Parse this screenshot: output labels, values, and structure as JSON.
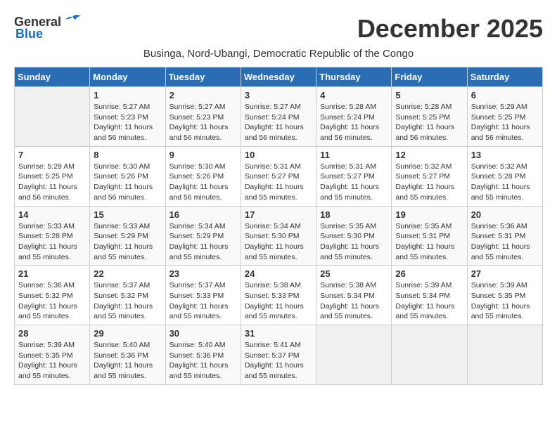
{
  "logo": {
    "general": "General",
    "blue": "Blue"
  },
  "title": "December 2025",
  "subtitle": "Businga, Nord-Ubangi, Democratic Republic of the Congo",
  "days_of_week": [
    "Sunday",
    "Monday",
    "Tuesday",
    "Wednesday",
    "Thursday",
    "Friday",
    "Saturday"
  ],
  "weeks": [
    [
      {
        "day": "",
        "sunrise": "",
        "sunset": "",
        "daylight": ""
      },
      {
        "day": "1",
        "sunrise": "Sunrise: 5:27 AM",
        "sunset": "Sunset: 5:23 PM",
        "daylight": "Daylight: 11 hours and 56 minutes."
      },
      {
        "day": "2",
        "sunrise": "Sunrise: 5:27 AM",
        "sunset": "Sunset: 5:23 PM",
        "daylight": "Daylight: 11 hours and 56 minutes."
      },
      {
        "day": "3",
        "sunrise": "Sunrise: 5:27 AM",
        "sunset": "Sunset: 5:24 PM",
        "daylight": "Daylight: 11 hours and 56 minutes."
      },
      {
        "day": "4",
        "sunrise": "Sunrise: 5:28 AM",
        "sunset": "Sunset: 5:24 PM",
        "daylight": "Daylight: 11 hours and 56 minutes."
      },
      {
        "day": "5",
        "sunrise": "Sunrise: 5:28 AM",
        "sunset": "Sunset: 5:25 PM",
        "daylight": "Daylight: 11 hours and 56 minutes."
      },
      {
        "day": "6",
        "sunrise": "Sunrise: 5:29 AM",
        "sunset": "Sunset: 5:25 PM",
        "daylight": "Daylight: 11 hours and 56 minutes."
      }
    ],
    [
      {
        "day": "7",
        "sunrise": "Sunrise: 5:29 AM",
        "sunset": "Sunset: 5:25 PM",
        "daylight": "Daylight: 11 hours and 56 minutes."
      },
      {
        "day": "8",
        "sunrise": "Sunrise: 5:30 AM",
        "sunset": "Sunset: 5:26 PM",
        "daylight": "Daylight: 11 hours and 56 minutes."
      },
      {
        "day": "9",
        "sunrise": "Sunrise: 5:30 AM",
        "sunset": "Sunset: 5:26 PM",
        "daylight": "Daylight: 11 hours and 56 minutes."
      },
      {
        "day": "10",
        "sunrise": "Sunrise: 5:31 AM",
        "sunset": "Sunset: 5:27 PM",
        "daylight": "Daylight: 11 hours and 55 minutes."
      },
      {
        "day": "11",
        "sunrise": "Sunrise: 5:31 AM",
        "sunset": "Sunset: 5:27 PM",
        "daylight": "Daylight: 11 hours and 55 minutes."
      },
      {
        "day": "12",
        "sunrise": "Sunrise: 5:32 AM",
        "sunset": "Sunset: 5:27 PM",
        "daylight": "Daylight: 11 hours and 55 minutes."
      },
      {
        "day": "13",
        "sunrise": "Sunrise: 5:32 AM",
        "sunset": "Sunset: 5:28 PM",
        "daylight": "Daylight: 11 hours and 55 minutes."
      }
    ],
    [
      {
        "day": "14",
        "sunrise": "Sunrise: 5:33 AM",
        "sunset": "Sunset: 5:28 PM",
        "daylight": "Daylight: 11 hours and 55 minutes."
      },
      {
        "day": "15",
        "sunrise": "Sunrise: 5:33 AM",
        "sunset": "Sunset: 5:29 PM",
        "daylight": "Daylight: 11 hours and 55 minutes."
      },
      {
        "day": "16",
        "sunrise": "Sunrise: 5:34 AM",
        "sunset": "Sunset: 5:29 PM",
        "daylight": "Daylight: 11 hours and 55 minutes."
      },
      {
        "day": "17",
        "sunrise": "Sunrise: 5:34 AM",
        "sunset": "Sunset: 5:30 PM",
        "daylight": "Daylight: 11 hours and 55 minutes."
      },
      {
        "day": "18",
        "sunrise": "Sunrise: 5:35 AM",
        "sunset": "Sunset: 5:30 PM",
        "daylight": "Daylight: 11 hours and 55 minutes."
      },
      {
        "day": "19",
        "sunrise": "Sunrise: 5:35 AM",
        "sunset": "Sunset: 5:31 PM",
        "daylight": "Daylight: 11 hours and 55 minutes."
      },
      {
        "day": "20",
        "sunrise": "Sunrise: 5:36 AM",
        "sunset": "Sunset: 5:31 PM",
        "daylight": "Daylight: 11 hours and 55 minutes."
      }
    ],
    [
      {
        "day": "21",
        "sunrise": "Sunrise: 5:36 AM",
        "sunset": "Sunset: 5:32 PM",
        "daylight": "Daylight: 11 hours and 55 minutes."
      },
      {
        "day": "22",
        "sunrise": "Sunrise: 5:37 AM",
        "sunset": "Sunset: 5:32 PM",
        "daylight": "Daylight: 11 hours and 55 minutes."
      },
      {
        "day": "23",
        "sunrise": "Sunrise: 5:37 AM",
        "sunset": "Sunset: 5:33 PM",
        "daylight": "Daylight: 11 hours and 55 minutes."
      },
      {
        "day": "24",
        "sunrise": "Sunrise: 5:38 AM",
        "sunset": "Sunset: 5:33 PM",
        "daylight": "Daylight: 11 hours and 55 minutes."
      },
      {
        "day": "25",
        "sunrise": "Sunrise: 5:38 AM",
        "sunset": "Sunset: 5:34 PM",
        "daylight": "Daylight: 11 hours and 55 minutes."
      },
      {
        "day": "26",
        "sunrise": "Sunrise: 5:39 AM",
        "sunset": "Sunset: 5:34 PM",
        "daylight": "Daylight: 11 hours and 55 minutes."
      },
      {
        "day": "27",
        "sunrise": "Sunrise: 5:39 AM",
        "sunset": "Sunset: 5:35 PM",
        "daylight": "Daylight: 11 hours and 55 minutes."
      }
    ],
    [
      {
        "day": "28",
        "sunrise": "Sunrise: 5:39 AM",
        "sunset": "Sunset: 5:35 PM",
        "daylight": "Daylight: 11 hours and 55 minutes."
      },
      {
        "day": "29",
        "sunrise": "Sunrise: 5:40 AM",
        "sunset": "Sunset: 5:36 PM",
        "daylight": "Daylight: 11 hours and 55 minutes."
      },
      {
        "day": "30",
        "sunrise": "Sunrise: 5:40 AM",
        "sunset": "Sunset: 5:36 PM",
        "daylight": "Daylight: 11 hours and 55 minutes."
      },
      {
        "day": "31",
        "sunrise": "Sunrise: 5:41 AM",
        "sunset": "Sunset: 5:37 PM",
        "daylight": "Daylight: 11 hours and 55 minutes."
      },
      {
        "day": "",
        "sunrise": "",
        "sunset": "",
        "daylight": ""
      },
      {
        "day": "",
        "sunrise": "",
        "sunset": "",
        "daylight": ""
      },
      {
        "day": "",
        "sunrise": "",
        "sunset": "",
        "daylight": ""
      }
    ]
  ]
}
